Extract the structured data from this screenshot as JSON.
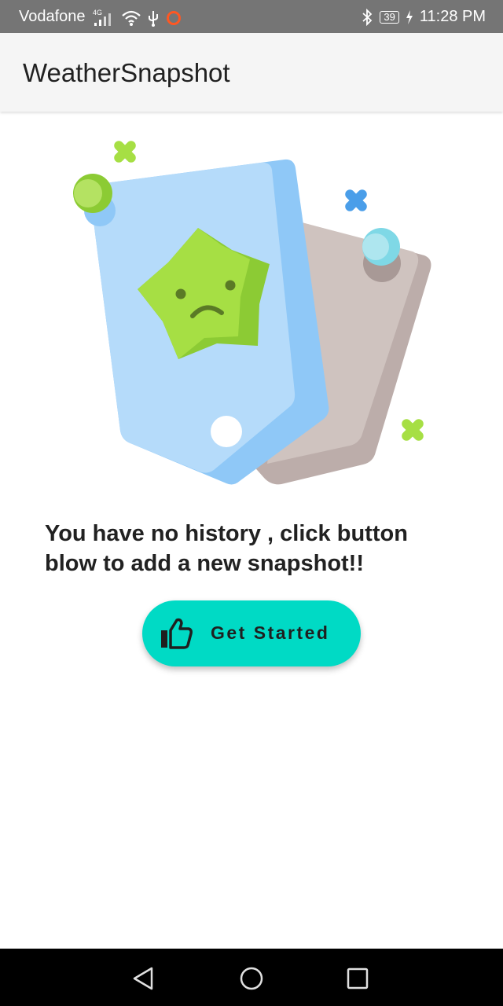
{
  "status_bar": {
    "carrier": "Vodafone",
    "network": "4G",
    "battery": "39",
    "time": "11:28 PM",
    "icons": [
      "signal-icon",
      "wifi-icon",
      "usb-icon",
      "notification-icon",
      "bluetooth-icon",
      "battery-icon",
      "charging-icon"
    ]
  },
  "app_bar": {
    "title": "WeatherSnapshot"
  },
  "empty_state": {
    "illustration_icon": "sad-star-cards-illustration",
    "message": "You have no history , click button blow to add a new snapshot!!"
  },
  "cta": {
    "label": "Get Started",
    "icon": "thumbs-up-icon",
    "color": "#00dac5"
  },
  "nav_bar": {
    "icons": [
      "back-icon",
      "home-icon",
      "recents-icon"
    ]
  }
}
